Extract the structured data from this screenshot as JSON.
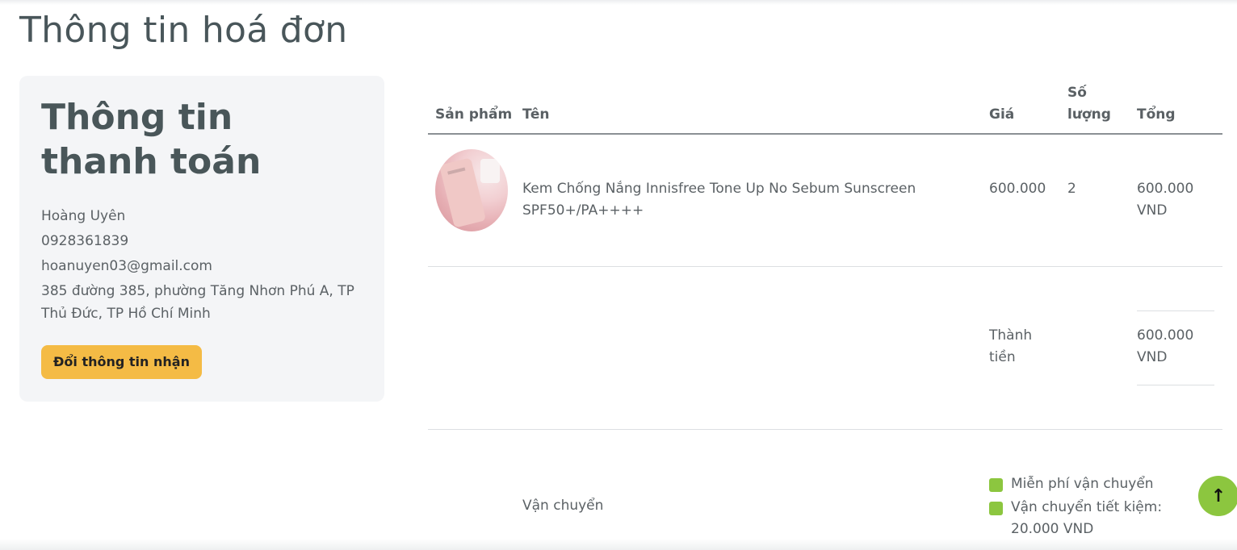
{
  "page": {
    "title": "Thông tin hoá đơn"
  },
  "billing": {
    "heading": "Thông tin thanh toán",
    "name": "Hoàng Uyên",
    "phone": "0928361839",
    "email": "hoanuyen03@gmail.com",
    "address": "385 đường 385, phường Tăng Nhơn Phú A, TP Thủ Đức, TP Hồ Chí Minh",
    "change_button": "Đổi thông tin nhận"
  },
  "table": {
    "headers": {
      "product": "Sản phẩm",
      "name": "Tên",
      "price": "Giá",
      "quantity": "Số lượng",
      "total": "Tổng"
    },
    "items": [
      {
        "image_icon": "product-photo",
        "name": "Kem Chống Nắng Innisfree Tone Up No Sebum Sunscreen SPF50+/PA++++",
        "price": "600.000",
        "quantity": "2",
        "total": "600.000 VND"
      }
    ],
    "subtotal": {
      "label": "Thành tiền",
      "value": "600.000 VND"
    },
    "shipping": {
      "label": "Vận chuyển",
      "options": [
        "Miễn phí vận chuyển",
        "Vận chuyển tiết kiệm: 20.000 VND"
      ]
    }
  },
  "scroll_top": {
    "icon": "arrow-up-icon",
    "glyph": "↑"
  },
  "colors": {
    "accent_button": "#f4bb45",
    "checkbox": "#8cc63f",
    "card_bg": "#f4f5f7"
  }
}
